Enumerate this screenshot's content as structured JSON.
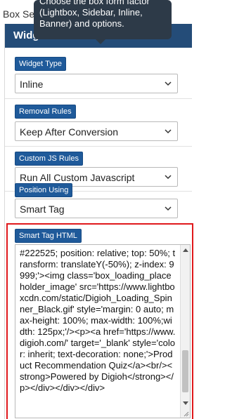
{
  "page_heading": "Box Settings",
  "panel": {
    "title": "Widget"
  },
  "tooltip": {
    "text": "Choose the box form factor (Lightbox, Sidebar, Inline, Banner) and options."
  },
  "fields": [
    {
      "label": "Widget Type",
      "value": "Inline"
    },
    {
      "label": "Removal Rules",
      "value": "Keep After Conversion"
    },
    {
      "label": "Custom JS Rules",
      "value": "Run All Custom Javascript"
    },
    {
      "label": "Position Using",
      "value": "Smart Tag"
    }
  ],
  "smart_tag": {
    "label": "Smart Tag HTML",
    "code": "#222525; position: relative; top: 50%; transform: translateY(-50%); z-index: 9999;'><img class='box_loading_placeholder_image' src='https://www.lightboxcdn.com/static/Digioh_Loading_Spinner_Black.gif' style='margin: 0 auto; max-height: 100%; max-width: 100%;width: 125px;'/><p><a href='https://www.digioh.com/' target='_blank' style='color: inherit; text-decoration: none;'>Product Recommendation Quiz</a><br/><strong>Powered by Digioh</strong></p></div></div></div>"
  },
  "colors": {
    "header_bg": "#244c78",
    "label_bg": "#1f5a9a",
    "highlight_border": "#e0191c",
    "tooltip_bg": "#2d3a48"
  }
}
